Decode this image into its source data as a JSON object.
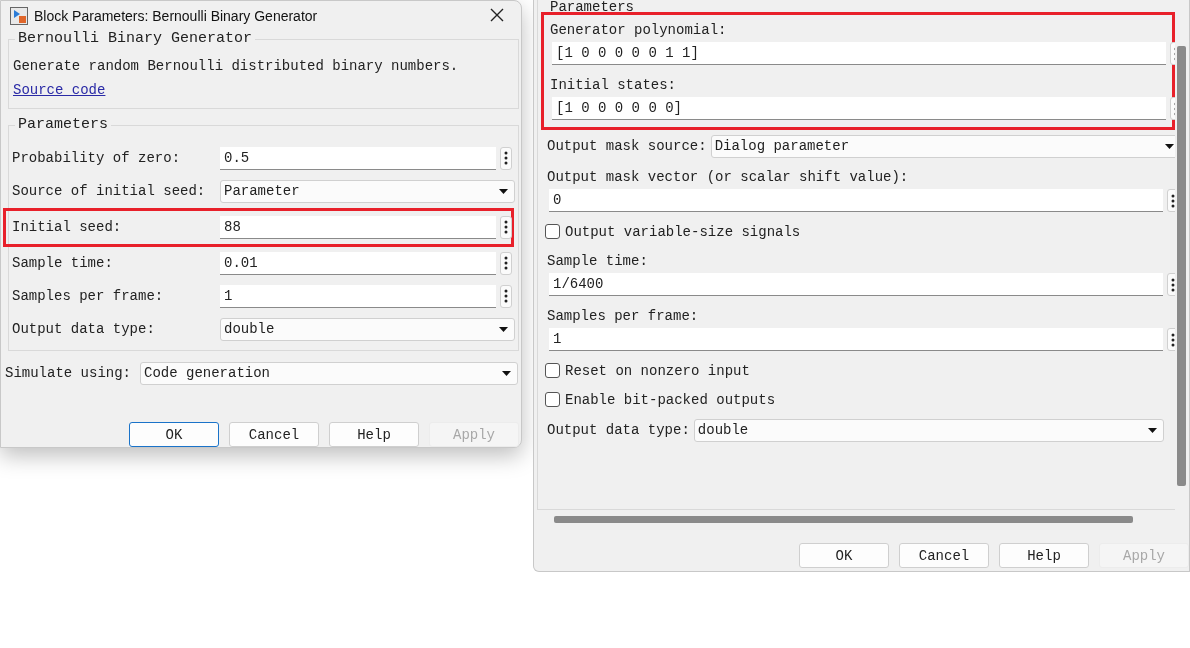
{
  "left_dialog": {
    "title": "Block Parameters: Bernoulli Binary Generator",
    "description_group": {
      "title": "Bernoulli Binary Generator",
      "text": "Generate random Bernoulli distributed binary numbers.",
      "link": "Source code"
    },
    "parameters_group": {
      "title": "Parameters",
      "rows": [
        {
          "kind": "edit",
          "label": "Probability of zero:",
          "value": "0.5",
          "highlighted": false
        },
        {
          "kind": "dropdown",
          "label": "Source of initial seed:",
          "value": "Parameter",
          "highlighted": false
        },
        {
          "kind": "edit",
          "label": "Initial seed:",
          "value": "88",
          "highlighted": true
        },
        {
          "kind": "edit",
          "label": "Sample time:",
          "value": "0.01",
          "highlighted": false
        },
        {
          "kind": "edit",
          "label": "Samples per frame:",
          "value": "1",
          "highlighted": false
        },
        {
          "kind": "dropdown",
          "label": "Output data type:",
          "value": "double",
          "highlighted": false
        }
      ]
    },
    "simulate": {
      "label": "Simulate using:",
      "value": "Code generation"
    },
    "buttons": [
      {
        "label": "OK",
        "focused": true,
        "disabled": false
      },
      {
        "label": "Cancel",
        "focused": false,
        "disabled": false
      },
      {
        "label": "Help",
        "focused": false,
        "disabled": false
      },
      {
        "label": "Apply",
        "focused": false,
        "disabled": true
      }
    ]
  },
  "right_dialog": {
    "group_title": "Parameters",
    "params": [
      {
        "kind": "stacked",
        "label": "Generator polynomial:",
        "value": "[1 0 0 0 0 0 1 1]",
        "highlighted": true
      },
      {
        "kind": "stacked",
        "label": "Initial states:",
        "value": "[1 0 0 0 0 0 0]",
        "highlighted": true
      },
      {
        "kind": "dropdown",
        "label": "Output mask source:",
        "value": "Dialog parameter",
        "highlighted": false
      },
      {
        "kind": "stacked",
        "label": "Output mask vector (or scalar shift value):",
        "value": "0",
        "highlighted": false
      },
      {
        "kind": "checkbox",
        "label": "Output variable-size signals",
        "checked": false,
        "highlighted": false
      },
      {
        "kind": "stacked",
        "label": "Sample time:",
        "value": "1/6400",
        "highlighted": false
      },
      {
        "kind": "stacked",
        "label": "Samples per frame:",
        "value": "1",
        "highlighted": false
      },
      {
        "kind": "checkbox",
        "label": "Reset on nonzero input",
        "checked": false,
        "highlighted": false
      },
      {
        "kind": "checkbox",
        "label": "Enable bit-packed outputs",
        "checked": false,
        "highlighted": false
      },
      {
        "kind": "dropdown",
        "label": "Output data type:",
        "value": "double",
        "highlighted": false
      }
    ],
    "buttons": [
      {
        "label": "OK",
        "focused": false,
        "disabled": false
      },
      {
        "label": "Cancel",
        "focused": false,
        "disabled": false
      },
      {
        "label": "Help",
        "focused": false,
        "disabled": false
      },
      {
        "label": "Apply",
        "focused": false,
        "disabled": true
      }
    ]
  }
}
